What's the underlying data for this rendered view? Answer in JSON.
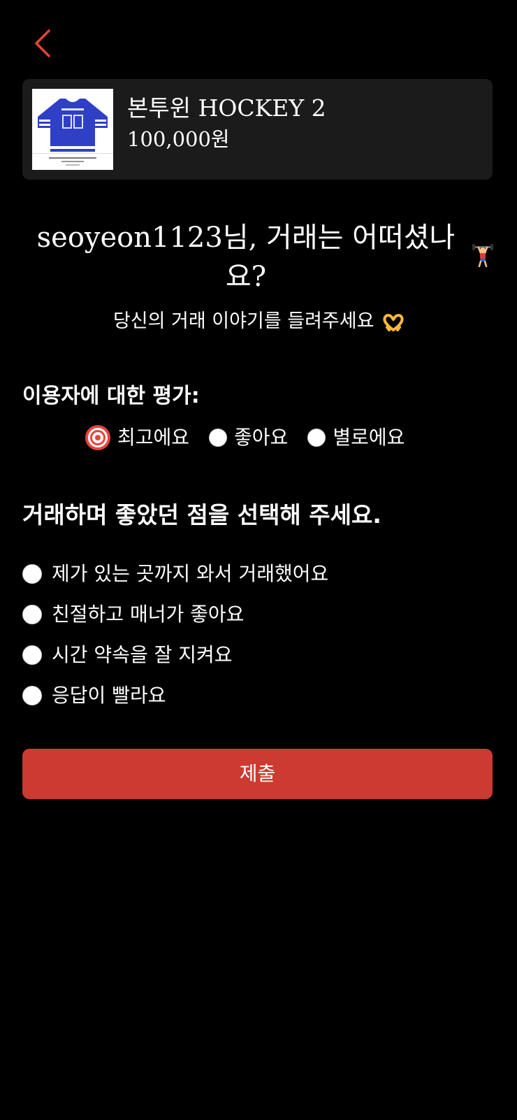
{
  "header": {
    "back_icon": "chevron-left-icon",
    "accent_color": "#e8433a"
  },
  "product": {
    "name": "본투윈 HOCKEY 2",
    "price": "100,000원",
    "thumbnail_icon": "hockey-jersey-image"
  },
  "headline": {
    "text": "seoyeon1123님, 거래는 어떠셨나요?",
    "emoji_icon": "weight-lifter-emoji"
  },
  "subtitle": {
    "text": "당신의 거래 이야기를 들려주세요",
    "emoji_icon": "heart-hands-emoji"
  },
  "rating": {
    "label": "이용자에 대한 평가:",
    "selected": "최고에요",
    "options": [
      {
        "label": "최고에요",
        "selected": true
      },
      {
        "label": "좋아요",
        "selected": false
      },
      {
        "label": "별로에요",
        "selected": false
      }
    ]
  },
  "good_points": {
    "label": "거래하며 좋았던 점을 선택해 주세요.",
    "options": [
      {
        "label": "제가 있는 곳까지 와서 거래했어요",
        "selected": false
      },
      {
        "label": "친절하고 매너가 좋아요",
        "selected": false
      },
      {
        "label": "시간 약속을 잘 지켜요",
        "selected": false
      },
      {
        "label": "응답이 빨라요",
        "selected": false
      }
    ]
  },
  "submit": {
    "label": "제출",
    "color": "#cc3a31"
  }
}
